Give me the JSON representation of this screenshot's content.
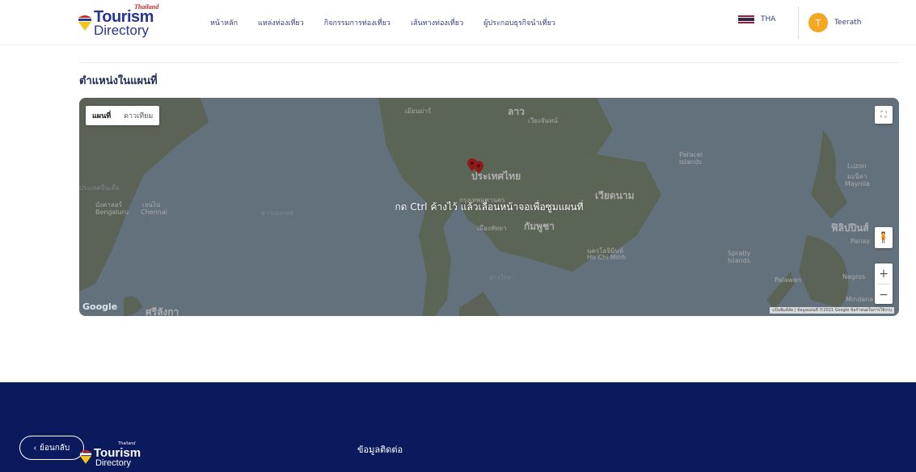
{
  "header": {
    "logo": {
      "tourism": "Tourism",
      "directory": "Directory",
      "thailand": "Thailand"
    },
    "nav": [
      {
        "label": "หน้าหลัก"
      },
      {
        "label": "แหล่งท่องเที่ยว"
      },
      {
        "label": "กิจกรรมการท่องเที่ยว"
      },
      {
        "label": "เส้นทางท่องเที่ยว"
      },
      {
        "label": "ผู้ประกอบธุรกิจนำเที่ยว"
      }
    ],
    "language": "THA",
    "user": {
      "initial": "T",
      "name": "Teerath"
    }
  },
  "section": {
    "title": "ตำแหน่งในแผนที่"
  },
  "map": {
    "type_buttons": {
      "map": "แผนที่",
      "satellite": "ดาวเทียม"
    },
    "overlay_message": "กด Ctrl ค้างไว้ แล้วเลื่อนหน้าจอเพื่อซูมแผนที่",
    "labels": {
      "yangon": "เมียนม่าร์",
      "laos": "ลาว",
      "vientiane": "เวียงจันทน์",
      "thailand": "ประเทศไทย",
      "bangkok": "กรุงเทพมหานคร",
      "vietnam": "เวียดนาม",
      "cambodia": "กัมพูชา",
      "pattaya": "เมืองพัทยา",
      "hcmc_th": "นครโฮจิมินห์",
      "hcmc": "Ho Chi Minh",
      "paracel": "Paracel Islands",
      "spratly": "Spratly Islands",
      "philippines": "ฟิลิปปินส์",
      "luzon": "Luzon",
      "manila": "มะนิลา",
      "maynila": "Maynila",
      "panay": "Panay",
      "negros": "Negros",
      "palawan": "Palawan",
      "mindanao": "Mindana",
      "bengaluru_th": "บังคาลอร์",
      "bengaluru": "Bengaluru",
      "chennai_th": "เจนไน",
      "chennai": "Chennai",
      "srilanka": "ศรีลังกา",
      "bay": "อ่าวเบงกอล",
      "gulf": "อ่าวไทย",
      "india": "ประเทศอินเดีย"
    },
    "attribution": "แป้นพิมพ์ลัด  |  ข้อมูลแผนที่ ©2021 Google  ข้อกำหนดในการใช้งาน",
    "google": "Google",
    "zoom_in": "+",
    "zoom_out": "−",
    "fullscreen": "⛶"
  },
  "footer": {
    "back": "ย้อนกลับ",
    "contact_title": "ข้อมูลติดต่อ",
    "logo": {
      "tourism": "Tourism",
      "directory": "Directory",
      "thailand": "Thailand"
    }
  },
  "colors": {
    "primary": "#283593",
    "footer_bg": "#0b1a5c",
    "avatar": "#f5a623",
    "marker": "#c62828"
  }
}
